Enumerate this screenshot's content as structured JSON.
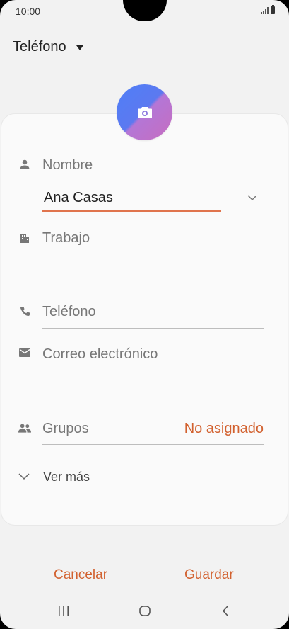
{
  "status_bar": {
    "time": "10:00"
  },
  "account_selector": {
    "label": "Teléfono"
  },
  "form": {
    "name": {
      "placeholder": "Nombre",
      "value": "Ana Casas"
    },
    "work": {
      "placeholder": "Trabajo"
    },
    "phone": {
      "placeholder": "Teléfono"
    },
    "email": {
      "placeholder": "Correo electrónico"
    },
    "groups": {
      "label": "Grupos",
      "value": "No asignado"
    },
    "more": {
      "label": "Ver más"
    }
  },
  "actions": {
    "cancel": "Cancelar",
    "save": "Guardar"
  },
  "colors": {
    "accent": "#d2612f",
    "underline_active": "#e0744d"
  }
}
